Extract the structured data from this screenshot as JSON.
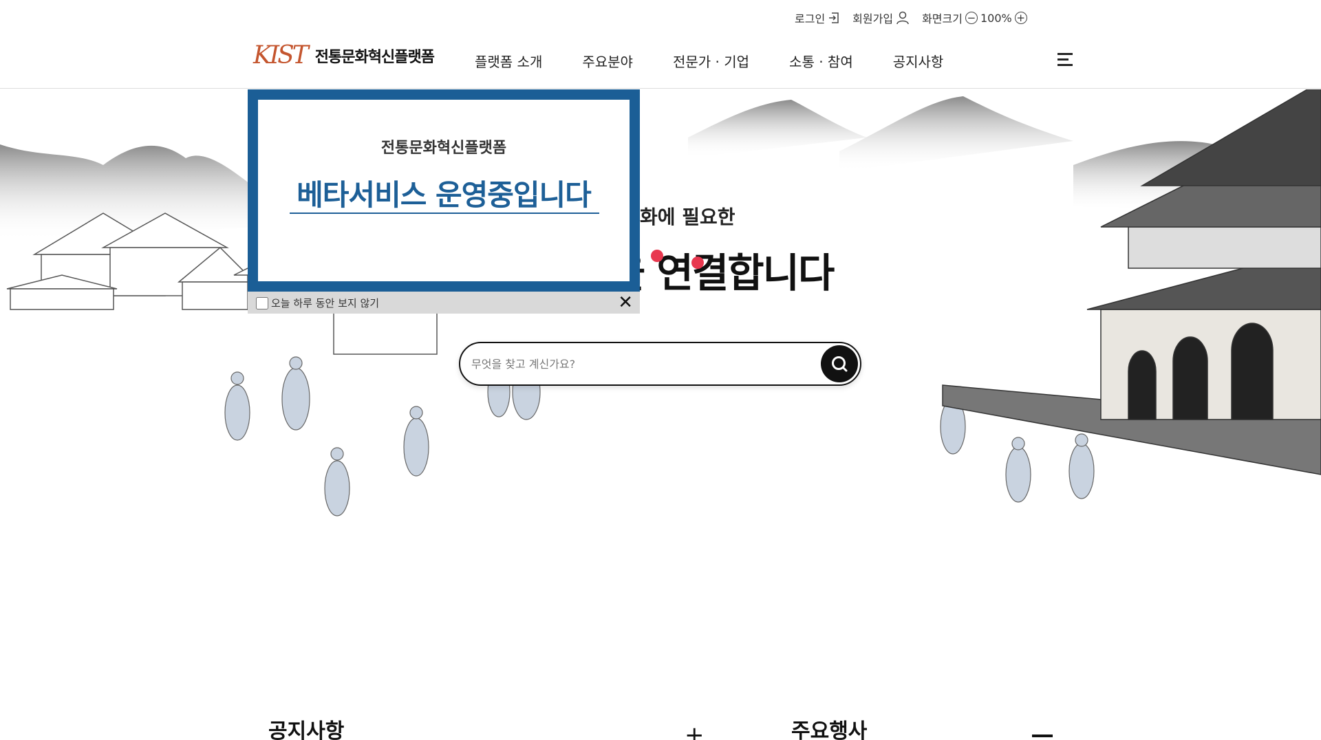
{
  "utility": {
    "login_label": "로그인",
    "signup_label": "회원가입",
    "zoom_label": "화면크기",
    "zoom_value": "100%"
  },
  "header": {
    "logo_mark": "KIST",
    "logo_text": "전통문화혁신플랫폼",
    "nav": [
      {
        "label": "플랫폼 소개"
      },
      {
        "label": "주요분야"
      },
      {
        "label": "전문가 · 기업"
      },
      {
        "label": "소통 · 참여"
      },
      {
        "label": "공지사항"
      }
    ]
  },
  "hero": {
    "subtitle_fragment": "화에 필요한",
    "title_fragment": "을 연결합니다",
    "search_placeholder": "무엇을 찾고 계신가요?"
  },
  "sections": {
    "notice_title": "공지사항",
    "events_title": "주요행사"
  },
  "popup": {
    "small_title": "전통문화혁신플랫폼",
    "big_title": "베타서비스 운영중입니다",
    "dismiss_label": "오늘 하루 동안 보지 않기",
    "close_symbol": "✕"
  },
  "colors": {
    "popup_border": "#1b5e96",
    "popup_text": "#1d5f97",
    "accent_dot": "#e8384f",
    "logo": "#c4552e"
  }
}
